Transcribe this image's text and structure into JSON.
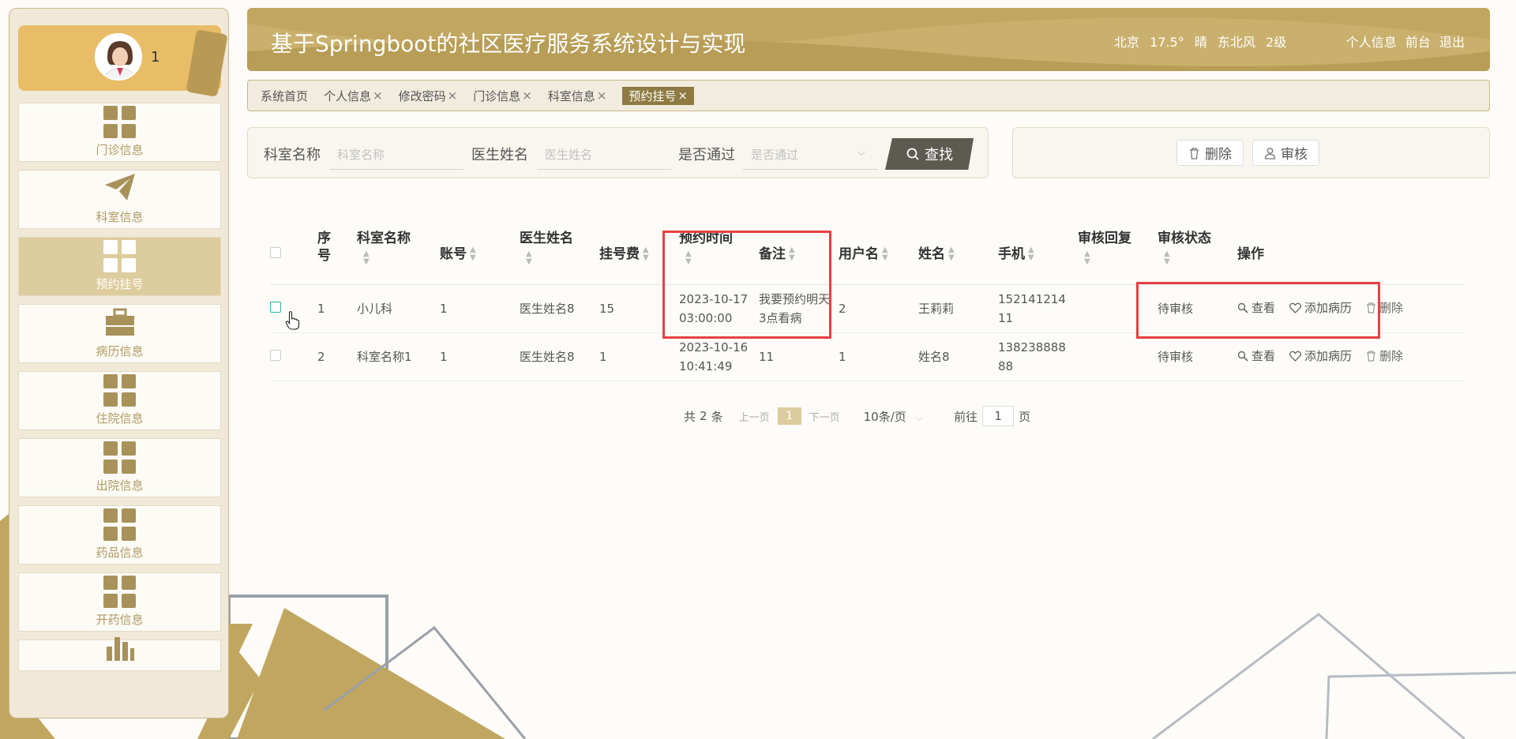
{
  "header": {
    "title": "基于Springboot的社区医疗服务系统设计与实现",
    "weather": {
      "city": "北京",
      "temp": "17.5°",
      "condition": "晴",
      "wind": "东北风",
      "level": "2级"
    },
    "links": [
      "个人信息",
      "前台",
      "退出"
    ]
  },
  "user": {
    "name": "1"
  },
  "sidebar": {
    "items": [
      {
        "label": "门诊信息",
        "icon": "grid-icon",
        "active": false
      },
      {
        "label": "科室信息",
        "icon": "paper-plane-icon",
        "active": false
      },
      {
        "label": "预约挂号",
        "icon": "grid-icon",
        "active": true
      },
      {
        "label": "病历信息",
        "icon": "briefcase-icon",
        "active": false
      },
      {
        "label": "住院信息",
        "icon": "grid-icon",
        "active": false
      },
      {
        "label": "出院信息",
        "icon": "grid-icon",
        "active": false
      },
      {
        "label": "药品信息",
        "icon": "grid-icon",
        "active": false
      },
      {
        "label": "开药信息",
        "icon": "grid-icon",
        "active": false
      },
      {
        "label": "",
        "icon": "bar-chart-icon",
        "active": false
      }
    ]
  },
  "tabs": [
    {
      "label": "系统首页",
      "closable": false,
      "active": false
    },
    {
      "label": "个人信息",
      "closable": true,
      "active": false
    },
    {
      "label": "修改密码",
      "closable": true,
      "active": false
    },
    {
      "label": "门诊信息",
      "closable": true,
      "active": false
    },
    {
      "label": "科室信息",
      "closable": true,
      "active": false
    },
    {
      "label": "预约挂号",
      "closable": true,
      "active": true
    }
  ],
  "tab_close": "×",
  "search": {
    "dept_label": "科室名称",
    "dept_placeholder": "科室名称",
    "doctor_label": "医生姓名",
    "doctor_placeholder": "医生姓名",
    "approved_label": "是否通过",
    "approved_placeholder": "是否通过",
    "search_button": "查找"
  },
  "actions": {
    "delete": "删除",
    "review": "审核"
  },
  "table": {
    "columns": [
      "序号",
      "科室名称",
      "账号",
      "医生姓名",
      "挂号费",
      "预约时间",
      "备注",
      "用户名",
      "姓名",
      "手机",
      "审核回复",
      "审核状态",
      "操作"
    ],
    "rows": [
      {
        "no": "1",
        "dept": "小儿科",
        "account": "1",
        "doctor": "医生姓名8",
        "fee": "15",
        "time": "2023-10-17 03:00:00",
        "note": "我要预约明天3点看病",
        "username": "2",
        "name": "王莉莉",
        "phone": "15214121411",
        "reply": "",
        "status": "待审核"
      },
      {
        "no": "2",
        "dept": "科室名称1",
        "account": "1",
        "doctor": "医生姓名8",
        "fee": "1",
        "time": "2023-10-16 10:41:49",
        "note": "11",
        "username": "1",
        "name": "姓名8",
        "phone": "13823888888",
        "reply": "",
        "status": "待审核"
      }
    ],
    "ops": {
      "view": "查看",
      "add_record": "添加病历",
      "delete": "删除"
    }
  },
  "pagination": {
    "total_prefix": "共",
    "total": "2",
    "total_suffix": "条",
    "prev": "上一页",
    "current": "1",
    "next": "下一页",
    "page_size": "10条/页",
    "goto_prefix": "前往",
    "goto_value": "1",
    "goto_suffix": "页"
  },
  "colors": {
    "accent": "#c1a660",
    "active_menu": "#ddcc9d",
    "highlight": "#e84040"
  }
}
